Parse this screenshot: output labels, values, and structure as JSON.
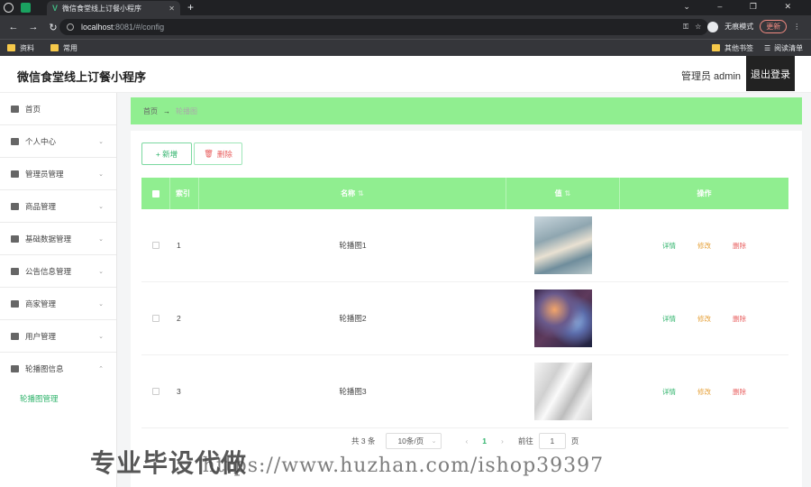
{
  "browser": {
    "tab_title": "微信食堂线上订餐小程序",
    "url_host": "localhost",
    "url_path": ":8081/#/config",
    "incognito_label": "无痕模式",
    "update_label": "更新",
    "bookmarks": [
      "资料",
      "常用"
    ],
    "bookmarks_right": [
      "其他书签",
      "阅读清单"
    ]
  },
  "header": {
    "title": "微信食堂线上订餐小程序",
    "user_label": "管理员 admin",
    "logout_label": "退出登录"
  },
  "sidebar": {
    "items": [
      {
        "label": "首页",
        "icon": "home-icon"
      },
      {
        "label": "个人中心",
        "icon": "user-icon"
      },
      {
        "label": "管理员管理",
        "icon": "admin-icon"
      },
      {
        "label": "商品管理",
        "icon": "goods-icon"
      },
      {
        "label": "基础数据管理",
        "icon": "data-icon"
      },
      {
        "label": "公告信息管理",
        "icon": "notice-icon"
      },
      {
        "label": "商家管理",
        "icon": "shop-icon"
      },
      {
        "label": "用户管理",
        "icon": "users-icon"
      },
      {
        "label": "轮播图信息",
        "icon": "carousel-icon"
      }
    ],
    "submenu": "轮播图管理"
  },
  "breadcrumb": {
    "home": "首页",
    "separator": "→",
    "current": "轮播图"
  },
  "toolbar": {
    "add_label": "+ 新增",
    "delete_label": "删除"
  },
  "table": {
    "headers": {
      "index": "索引",
      "name": "名称",
      "value": "值",
      "ops": "操作"
    },
    "rows": [
      {
        "index": "1",
        "name": "轮播图1"
      },
      {
        "index": "2",
        "name": "轮播图2"
      },
      {
        "index": "3",
        "name": "轮播图3"
      }
    ],
    "ops": {
      "view": "详情",
      "edit": "修改",
      "delete": "删除"
    }
  },
  "pagination": {
    "total": "共 3 条",
    "page_size": "10条/页",
    "current_page": "1",
    "goto_label": "前往",
    "goto_value": "1",
    "page_suffix": "页"
  },
  "watermark": {
    "text": "专业毕设代做",
    "url": "https://www.huzhan.com/ishop39397"
  }
}
